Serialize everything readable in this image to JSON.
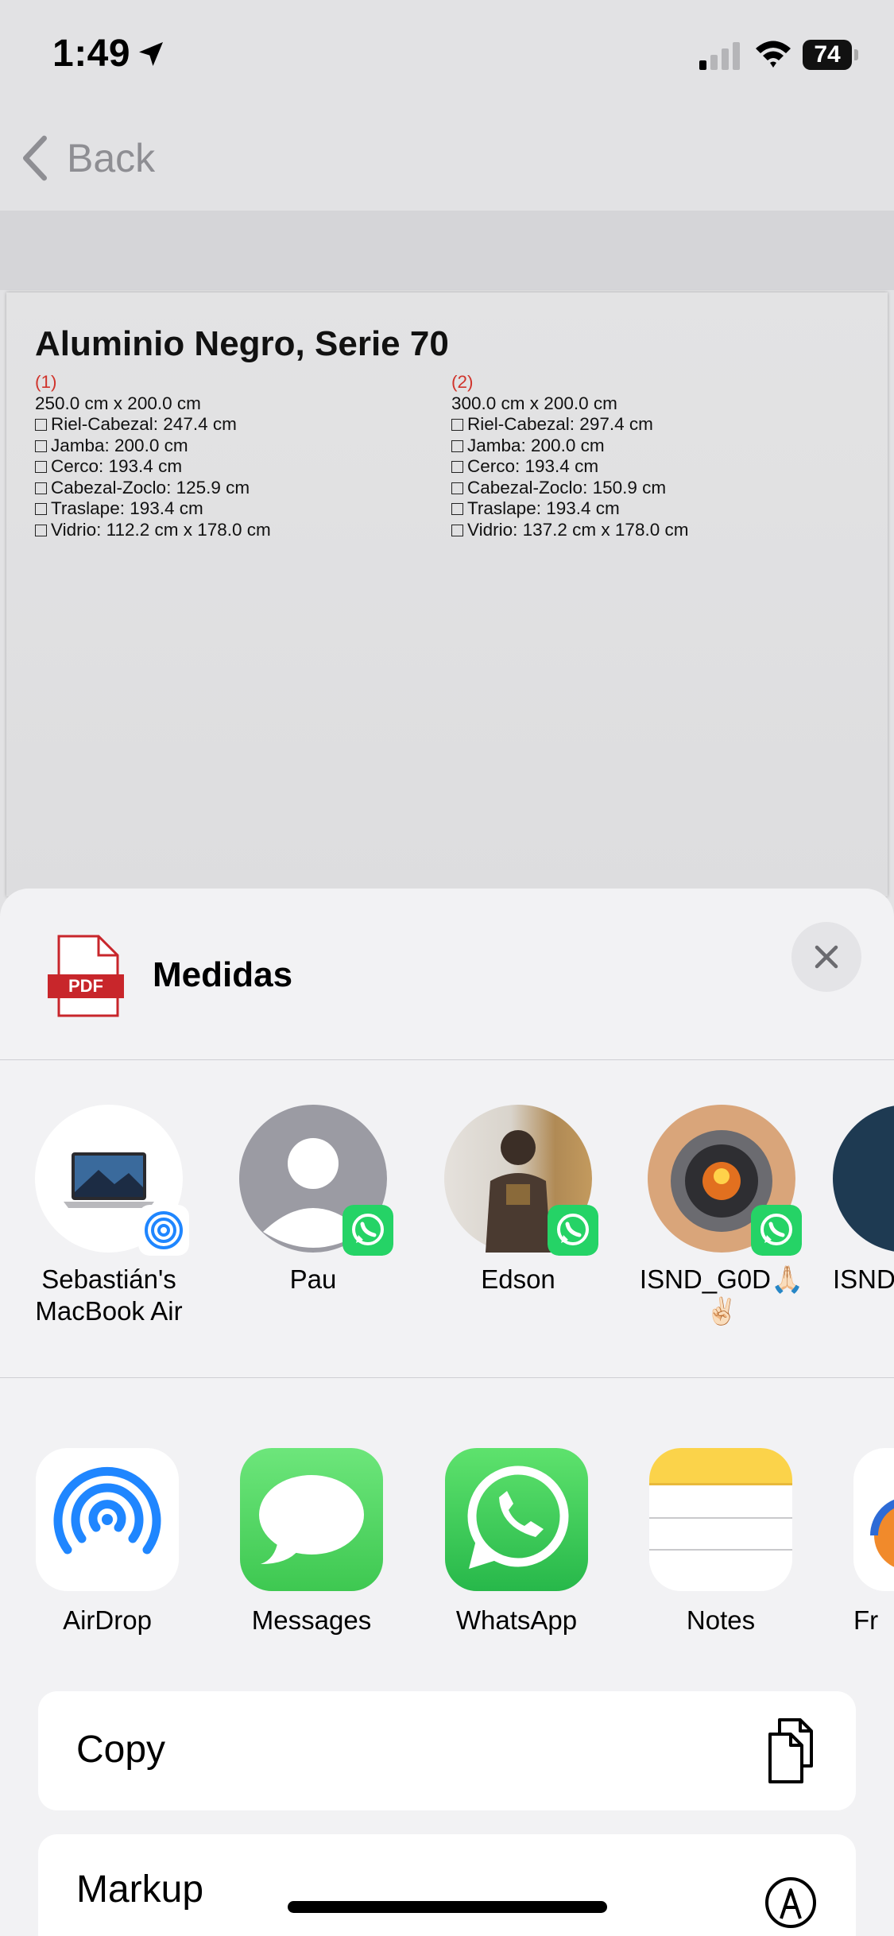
{
  "status_bar": {
    "time": "1:49",
    "battery": "74"
  },
  "nav": {
    "back_label": "Back"
  },
  "document": {
    "title": "Aluminio Negro, Serie 70",
    "columns": [
      {
        "number": "(1)",
        "size": "250.0 cm x 200.0 cm",
        "items": [
          "Riel-Cabezal: 247.4 cm",
          "Jamba: 200.0 cm",
          "Cerco: 193.4 cm",
          "Cabezal-Zoclo: 125.9 cm",
          "Traslape: 193.4 cm",
          "Vidrio: 112.2 cm x 178.0 cm"
        ]
      },
      {
        "number": "(2)",
        "size": "300.0 cm x 200.0 cm",
        "items": [
          "Riel-Cabezal: 297.4 cm",
          "Jamba: 200.0 cm",
          "Cerco: 193.4 cm",
          "Cabezal-Zoclo: 150.9 cm",
          "Traslape: 193.4 cm",
          "Vidrio: 137.2 cm x 178.0 cm"
        ]
      }
    ]
  },
  "share": {
    "doc_name": "Medidas",
    "file_type": "PDF",
    "people": [
      {
        "line1": "Sebastián's",
        "line2": "MacBook Air",
        "badge": "airdrop-icon"
      },
      {
        "line1": "Pau",
        "line2": "",
        "badge": "whatsapp-icon"
      },
      {
        "line1": "Edson",
        "line2": "",
        "badge": "whatsapp-icon"
      },
      {
        "line1": "ISND_G0D🙏🏻",
        "line2": "✌🏻",
        "badge": "whatsapp-icon"
      },
      {
        "line1": "ISND",
        "line2": "",
        "badge": ""
      }
    ],
    "apps": [
      {
        "label": "AirDrop",
        "icon": "airdrop-icon"
      },
      {
        "label": "Messages",
        "icon": "messages-icon"
      },
      {
        "label": "WhatsApp",
        "icon": "whatsapp-icon"
      },
      {
        "label": "Notes",
        "icon": "notes-icon"
      },
      {
        "label": "Fr",
        "icon": "freeform-icon"
      }
    ],
    "actions": [
      {
        "label": "Copy",
        "icon": "copy-icon"
      },
      {
        "label": "Markup",
        "icon": "markup-icon"
      }
    ]
  },
  "colors": {
    "accent_blue": "#1f86ff",
    "whatsapp_green": "#25d366",
    "messages_green": "#4cd964",
    "pdf_red": "#c8262b",
    "doc_number_red": "#d0342c"
  }
}
